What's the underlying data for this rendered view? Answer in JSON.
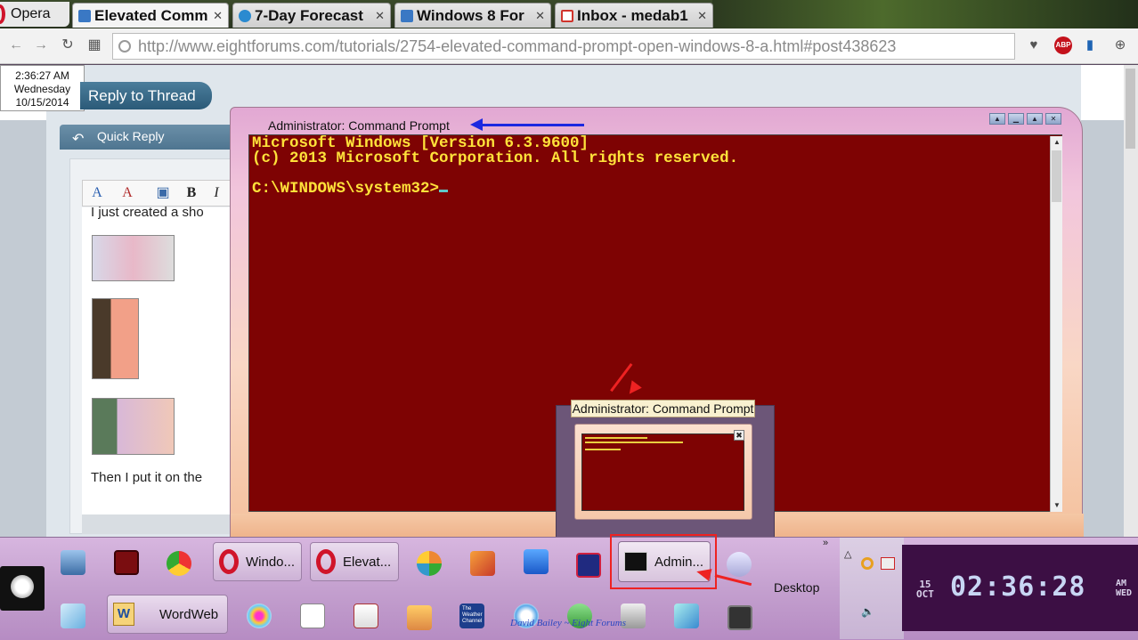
{
  "browser": {
    "menu_label": "Opera",
    "tabs": [
      {
        "title": "Elevated Comm",
        "close": "✕",
        "color": "#3a78c4"
      },
      {
        "title": "7-Day Forecast",
        "close": "✕",
        "color": "#2a8ad0"
      },
      {
        "title": "Windows 8 For",
        "close": "✕",
        "color": "#3a78c4"
      },
      {
        "title": "Inbox - medab1",
        "close": "✕",
        "color": "#d0342c"
      }
    ],
    "address": "http://www.eightforums.com/tutorials/2754-elevated-command-prompt-open-windows-8-a.html#post438623",
    "ext_abp": "ABP"
  },
  "clock_tooltip": {
    "time": "2:36:27 AM",
    "day": "Wednesday",
    "date": "10/15/2014"
  },
  "page": {
    "reply_button": "Reply to Thread",
    "quick_reply": "Quick Reply",
    "editor_text_1": "I just created a sho",
    "editor_text_2": "Then I put it on the",
    "toolbar_bold": "B",
    "toolbar_italic": "I"
  },
  "cmd_window": {
    "title": "Administrator: Command Prompt",
    "lines": [
      "Microsoft Windows [Version 6.3.9600]",
      "(c) 2013 Microsoft Corporation. All rights reserved.",
      "",
      "C:\\WINDOWS\\system32>"
    ],
    "console_bg": "#7e0303",
    "console_fg": "#ffe23a"
  },
  "preview": {
    "label": "Administrator: Command Prompt",
    "close": "✖"
  },
  "taskbar": {
    "buttons": [
      {
        "label": "Windo..."
      },
      {
        "label": "Elevat..."
      }
    ],
    "admin_label": "Admin...",
    "wordweb_label": "WordWeb",
    "wordweb_letter": "W",
    "weather_label": "The Weather Channel",
    "desktop_label": "Desktop",
    "signature": "David Bailey ~ Eight Forums"
  },
  "clock": {
    "day_num": "15",
    "month": "OCT",
    "time": "02:36:28",
    "ampm": "AM",
    "weekday": "WED"
  }
}
